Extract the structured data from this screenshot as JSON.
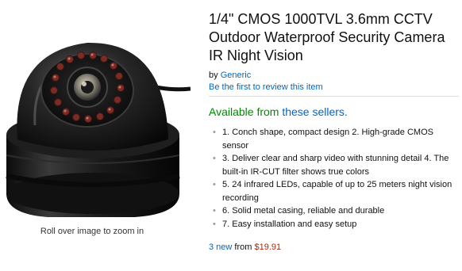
{
  "image": {
    "alt": "Dome CCTV security camera",
    "zoom_hint": "Roll over image to zoom in"
  },
  "product": {
    "title": "1/4\" CMOS 1000TVL 3.6mm CCTV Outdoor Waterproof Security Camera IR Night Vision",
    "by_prefix": "by",
    "brand": "Generic",
    "review_link": "Be the first to review this item"
  },
  "availability": {
    "text": "Available from",
    "sellers_link": "these sellers."
  },
  "features": [
    "1. Conch shape, compact design 2. High-grade CMOS sensor",
    "3. Deliver clear and sharp video with stunning detail 4. The built-in IR-CUT filter shows true colors",
    "5. 24 infrared LEDs, capable of up to 25 meters night vision recording",
    "6. Solid metal casing, reliable and durable",
    "7. Easy installation and easy setup"
  ],
  "offers": {
    "count_label": "3 new",
    "from_text": "from",
    "price": "$19.91"
  },
  "colors": {
    "link": "#0066c0",
    "availability_green": "#008a00",
    "price_red": "#b12704",
    "divider": "#dddddd"
  }
}
